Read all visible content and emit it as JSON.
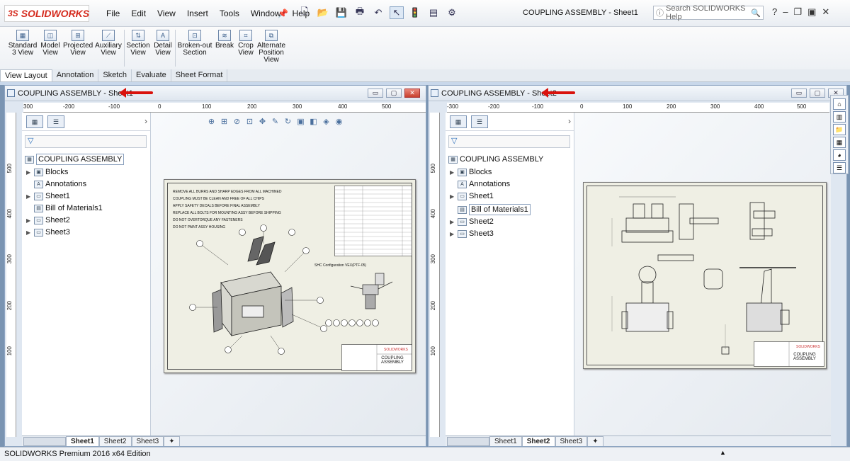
{
  "app": {
    "logo_text": "SOLIDWORKS",
    "logo_prefix": "3S",
    "menu": [
      "File",
      "Edit",
      "View",
      "Insert",
      "Tools",
      "Window",
      "Help"
    ],
    "document_title": "COUPLING ASSEMBLY - Sheet1",
    "search_placeholder": "Search SOLIDWORKS Help",
    "help_label": "?",
    "status": "SOLIDWORKS Premium 2016 x64 Edition",
    "accent_color": "#d52b1e"
  },
  "ribbon": {
    "buttons": [
      {
        "label": "Standard\n3 View",
        "icon": "standard-3-view-icon"
      },
      {
        "label": "Model\nView",
        "icon": "model-view-icon"
      },
      {
        "label": "Projected\nView",
        "icon": "projected-view-icon"
      },
      {
        "label": "Auxiliary\nView",
        "icon": "auxiliary-view-icon"
      },
      {
        "label": "Section\nView",
        "icon": "section-view-icon"
      },
      {
        "label": "Detail\nView",
        "icon": "detail-view-icon"
      },
      {
        "label": "Broken-out\nSection",
        "icon": "broken-out-section-icon"
      },
      {
        "label": "Break",
        "icon": "break-icon"
      },
      {
        "label": "Crop\nView",
        "icon": "crop-view-icon"
      },
      {
        "label": "Alternate\nPosition\nView",
        "icon": "alternate-position-view-icon"
      }
    ],
    "tabs": [
      "View Layout",
      "Annotation",
      "Sketch",
      "Evaluate",
      "Sheet Format"
    ],
    "active_tab": "View Layout"
  },
  "panes": [
    {
      "title": "COUPLING ASSEMBLY - Sheet1",
      "ruler_labels": [
        "300",
        "-200",
        "-100",
        "0",
        "100",
        "200",
        "300",
        "400",
        "500"
      ],
      "vruler_labels": [
        "500",
        "400",
        "300",
        "200",
        "100"
      ],
      "tree_root": "COUPLING ASSEMBLY",
      "tree_items": [
        "Blocks",
        "Annotations",
        "Sheet1",
        "Bill of Materials1",
        "Sheet2",
        "Sheet3"
      ],
      "sheet_tabs": [
        "Sheet1",
        "Sheet2",
        "Sheet3"
      ],
      "active_sheet": "Sheet1",
      "notes": [
        "REMOVE ALL BURRS AND SHARP EDGES FROM ALL MACHINED",
        "COUPLING MUST BE CLEAN AND FREE OF ALL CHIPS",
        "APPLY SAFETY DECALS BEFORE FINAL ASSEMBLY",
        "REPLACE ALL BOLTS FOR MOUNTING ASSY BEFORE SHIPPING",
        "DO NOT OVERTORQUE ANY FASTENERS",
        "DO NOT PAINT ASSY HOUSING"
      ],
      "detail_label": "SHC Configuration VEX(PTF-05)",
      "title_block": "COUPLING\nASSEMBLY"
    },
    {
      "title": "COUPLING ASSEMBLY - Sheet2",
      "ruler_labels": [
        "-300",
        "-200",
        "-100",
        "0",
        "100",
        "200",
        "300",
        "400",
        "500"
      ],
      "vruler_labels": [
        "500",
        "400",
        "300",
        "200",
        "100"
      ],
      "tree_root": "COUPLING ASSEMBLY",
      "tree_items": [
        "Blocks",
        "Annotations",
        "Sheet1",
        "Bill of Materials1",
        "Sheet2",
        "Sheet3"
      ],
      "sheet_tabs": [
        "Sheet1",
        "Sheet2",
        "Sheet3"
      ],
      "active_sheet": "Sheet2",
      "title_block": "COUPLING\nASSEMBLY"
    }
  ]
}
